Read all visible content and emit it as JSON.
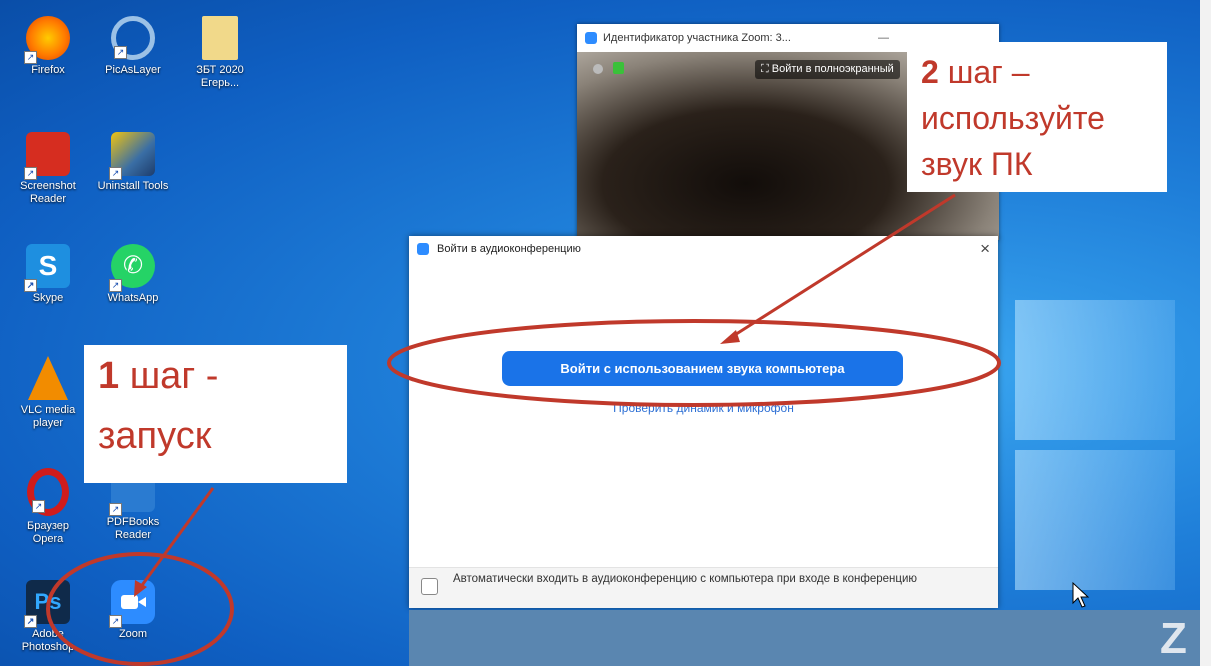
{
  "desktop": {
    "icons": [
      {
        "label": "Firefox",
        "icon": "firefox-icon",
        "color": "#e66000"
      },
      {
        "label": "PicAsLayer",
        "icon": "picaslayer-icon",
        "color": "#8fb4d9"
      },
      {
        "label": "ЗБТ 2020\nЕгерь...",
        "icon": "folder-icon",
        "color": "#e8c76a"
      },
      {
        "label": "Screenshot\nReader",
        "icon": "screenshot-reader-icon",
        "color": "#d62d20"
      },
      {
        "label": "Uninstall Tools",
        "icon": "uninstall-tools-icon",
        "color": "#3a6ea5"
      },
      {
        "label": "Skype",
        "icon": "skype-icon",
        "color": "#00aff0"
      },
      {
        "label": "WhatsApp",
        "icon": "whatsapp-icon",
        "color": "#25d366"
      },
      {
        "label": "VLC media\nplayer",
        "icon": "vlc-icon",
        "color": "#f28c00"
      },
      {
        "label": "Браузер\nOpera",
        "icon": "opera-icon",
        "color": "#cc1b1b"
      },
      {
        "label": "PDFBooks\nReader",
        "icon": "pdf-reader-icon",
        "color": "#2a7bd1"
      },
      {
        "label": "Adobe\nPhotoshop",
        "icon": "photoshop-icon",
        "color": "#1e3f6b"
      },
      {
        "label": "Zoom",
        "icon": "zoom-icon",
        "color": "#2d8cff"
      }
    ]
  },
  "video_window": {
    "title": "Идентификатор участника Zoom: 3...",
    "fullscreen_label": "Войти в полноэкранный"
  },
  "audio_dialog": {
    "title": "Войти в аудиоконференцию",
    "close_label": "×",
    "join_button": "Войти с использованием звука компьютера",
    "test_link": "Проверить динамик и микрофон",
    "auto_join": "Автоматически входить в аудиоконференцию с компьютера при входе в конференцию"
  },
  "annotations": {
    "step1": {
      "number": "1",
      "line1": " шаг -",
      "line2": "запуск"
    },
    "step2": {
      "number": "2",
      "line1": " шаг –",
      "line2": "используйте",
      "line3": "звук ПК"
    },
    "color": "#c0392b"
  },
  "accent_color": "#1a73e8"
}
